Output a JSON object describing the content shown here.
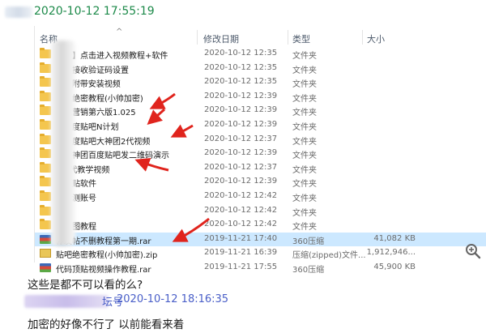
{
  "message1": {
    "time": "2020-10-12 17:55:19"
  },
  "explorer": {
    "columns": {
      "name": "名称",
      "date": "修改日期",
      "type": "类型",
      "size": "大小"
    },
    "rows": [
      {
        "name": "神器】点击进入视频教程+软件",
        "date": "2020-10-12 12:35",
        "type": "文件夹",
        "size": "",
        "icon": "folder-icon",
        "selected": false
      },
      {
        "name": "阳精接收验证码设置",
        "date": "2020-10-12 12:35",
        "type": "文件夹",
        "size": "",
        "icon": "folder-icon",
        "selected": false
      },
      {
        "name": "CS6附带安装视频",
        "date": "2020-10-12 12:35",
        "type": "文件夹",
        "size": "",
        "icon": "folder-icon",
        "selected": false
      },
      {
        "name": "贴吧绝密教程(小帅加密)",
        "date": "2020-10-12 12:39",
        "type": "文件夹",
        "size": "",
        "icon": "folder-icon",
        "selected": false
      },
      {
        "name": "贴吧营销第六版1.025",
        "date": "2020-10-12 12:39",
        "type": "文件夹",
        "size": "",
        "icon": "folder-icon",
        "selected": false
      },
      {
        "name": "队百度贴吧N计划",
        "date": "2020-10-12 12:39",
        "type": "文件夹",
        "size": "",
        "icon": "folder-icon",
        "selected": false
      },
      {
        "name": "队百度贴吧大神团2代视频",
        "date": "2020-10-12 12:37",
        "type": "文件夹",
        "size": "",
        "icon": "folder-icon",
        "selected": false
      },
      {
        "name": "队大神团百度贴吧发二维码演示",
        "date": "2020-10-12 12:39",
        "type": "文件夹",
        "size": "",
        "icon": "folder-icon",
        "selected": false
      },
      {
        "name": "校3代教学视频",
        "date": "2020-10-12 12:37",
        "type": "文件夹",
        "size": "",
        "icon": "folder-icon",
        "selected": false
      },
      {
        "name": "贴顶贴软件",
        "date": "2020-10-12 12:39",
        "type": "文件夹",
        "size": "",
        "icon": "folder-icon",
        "selected": false
      },
      {
        "name": "防检测账号",
        "date": "2020-10-12 12:42",
        "type": "文件夹",
        "size": "",
        "icon": "folder-icon",
        "selected": false
      },
      {
        "name": "行榜",
        "date": "2020-10-12 12:42",
        "type": "文件夹",
        "size": "",
        "icon": "folder-icon",
        "selected": false
      },
      {
        "name": "操作图教程",
        "date": "2020-10-12 12:42",
        "type": "文件夹",
        "size": "",
        "icon": "folder-icon",
        "selected": false
      },
      {
        "name": "作发帖不删教程第一期.rar",
        "date": "2019-11-21 17:40",
        "type": "360压缩",
        "size": "41,082 KB",
        "icon": "archive-icon",
        "selected": true
      },
      {
        "name": "贴吧绝密教程(小帅加密).zip",
        "date": "2019-11-21 16:39",
        "type": "压缩(zipped)文件...",
        "size": "1,912,946...",
        "icon": "zip-icon",
        "selected": false
      },
      {
        "name": "代码顶贴视频操作教程.rar",
        "date": "2019-11-21 17:55",
        "type": "360压缩",
        "size": "45,900 KB",
        "icon": "archive-icon",
        "selected": false
      }
    ]
  },
  "message1_text": "这些是都不可以看的么?",
  "message2": {
    "sender_tail": "坛号",
    "time": "2020-10-12 18:16:35",
    "text": "加密的好像不行了 以前能看来着"
  },
  "colors": {
    "timestamp_green": "#1d8a4a",
    "timestamp_blue": "#4a5fc8",
    "arrow_red": "#e0241d",
    "selection": "#cce8ff",
    "folder": "#f4c64e"
  }
}
